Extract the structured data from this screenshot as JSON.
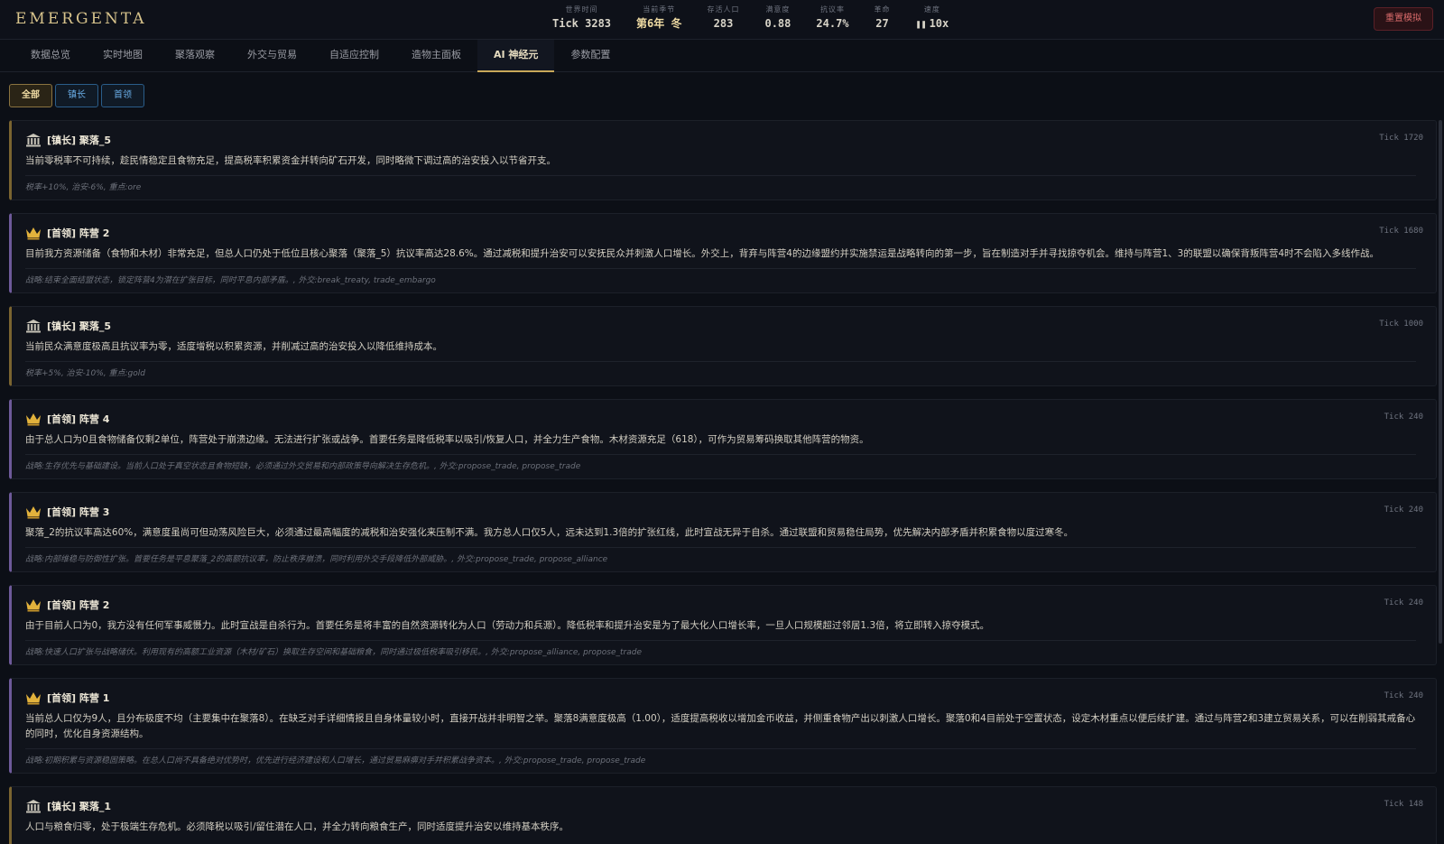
{
  "app": {
    "logo": "EMERGENTA"
  },
  "stats": [
    {
      "label": "世界时间",
      "value": "Tick 3283"
    },
    {
      "label": "当前季节",
      "value": "第6年 冬"
    },
    {
      "label": "存活人口",
      "value": "283"
    },
    {
      "label": "满意度",
      "value": "0.88"
    },
    {
      "label": "抗议率",
      "value": "24.7%"
    },
    {
      "label": "革命",
      "value": "27"
    },
    {
      "label": "速度",
      "value": "10x",
      "icon": "pause-icon"
    }
  ],
  "reset_label": "重置模拟",
  "tabs": [
    {
      "label": "数据总览"
    },
    {
      "label": "实时地图"
    },
    {
      "label": "聚落观察"
    },
    {
      "label": "外交与贸易"
    },
    {
      "label": "自适应控制"
    },
    {
      "label": "造物主面板"
    },
    {
      "label": "AI 神经元",
      "active": true
    },
    {
      "label": "参数配置"
    }
  ],
  "filters": [
    {
      "label": "全部",
      "active": true
    },
    {
      "label": "镇长"
    },
    {
      "label": "首领"
    }
  ],
  "colors": {
    "gold_accent": "#c9a85a",
    "mayor_border": "#7a6430",
    "leader_border": "#6e5a9a",
    "danger": "#d86a6a"
  },
  "cards": [
    {
      "kind": "mayor",
      "icon": "bank-icon",
      "title": "[镇长] 聚落_5",
      "tick": "Tick 1720",
      "body": "当前零税率不可持续，趁民情稳定且食物充足，提高税率积累资金并转向矿石开发，同时略微下调过高的治安投入以节省开支。",
      "note": "税率+10%, 治安-6%, 重点:ore"
    },
    {
      "kind": "leader",
      "icon": "crown-icon",
      "title": "[首领] 阵营 2",
      "tick": "Tick 1680",
      "body": "目前我方资源储备（食物和木材）非常充足，但总人口仍处于低位且核心聚落（聚落_5）抗议率高达28.6%。通过减税和提升治安可以安抚民众并刺激人口增长。外交上，背弃与阵营4的边缘盟约并实施禁运是战略转向的第一步，旨在制造对手并寻找掠夺机会。维持与阵营1、3的联盟以确保背叛阵营4时不会陷入多线作战。",
      "note": "战略:结束全面结盟状态，锁定阵营4为潜在扩张目标，同时平息内部矛盾。, 外交:break_treaty, trade_embargo"
    },
    {
      "kind": "mayor",
      "icon": "bank-icon",
      "title": "[镇长] 聚落_5",
      "tick": "Tick 1000",
      "body": "当前民众满意度极高且抗议率为零，适度增税以积累资源，并削减过高的治安投入以降低维持成本。",
      "note": "税率+5%, 治安-10%, 重点:gold"
    },
    {
      "kind": "leader",
      "icon": "crown-icon",
      "title": "[首领] 阵营 4",
      "tick": "Tick 240",
      "body": "由于总人口为0且食物储备仅剩2单位，阵营处于崩溃边缘。无法进行扩张或战争。首要任务是降低税率以吸引/恢复人口，并全力生产食物。木材资源充足（618），可作为贸易筹码换取其他阵营的物资。",
      "note": "战略:生存优先与基础建设。当前人口处于真空状态且食物短缺，必须通过外交贸易和内部政策导向解决生存危机。, 外交:propose_trade, propose_trade"
    },
    {
      "kind": "leader",
      "icon": "crown-icon",
      "title": "[首领] 阵营 3",
      "tick": "Tick 240",
      "body": "聚落_2的抗议率高达60%，满意度虽尚可但动荡风险巨大，必须通过最高幅度的减税和治安强化来压制不满。我方总人口仅5人，远未达到1.3倍的扩张红线，此时宣战无异于自杀。通过联盟和贸易稳住局势，优先解决内部矛盾并积累食物以度过寒冬。",
      "note": "战略:内部维稳与防御性扩张。首要任务是平息聚落_2的高额抗议率，防止秩序崩溃，同时利用外交手段降低外部威胁。, 外交:propose_trade, propose_alliance"
    },
    {
      "kind": "leader",
      "icon": "crown-icon",
      "title": "[首领] 阵营 2",
      "tick": "Tick 240",
      "body": "由于目前人口为0，我方没有任何军事威慑力。此时宣战是自杀行为。首要任务是将丰富的自然资源转化为人口（劳动力和兵源）。降低税率和提升治安是为了最大化人口增长率，一旦人口规模超过邻居1.3倍，将立即转入掠夺模式。",
      "note": "战略:快速人口扩张与战略储伏。利用现有的高额工业资源（木材/矿石）换取生存空间和基础粮食，同时通过极低税率吸引移民。, 外交:propose_alliance, propose_trade"
    },
    {
      "kind": "leader",
      "icon": "crown-icon",
      "title": "[首领] 阵营 1",
      "tick": "Tick 240",
      "body": "当前总人口仅为9人，且分布极度不均（主要集中在聚落8）。在缺乏对手详细情报且自身体量较小时，直接开战并非明智之举。聚落8满意度极高（1.00），适度提高税收以增加金币收益，并侧重食物产出以刺激人口增长。聚落0和4目前处于空置状态，设定木材重点以便后续扩建。通过与阵营2和3建立贸易关系，可以在削弱其戒备心的同时，优化自身资源结构。",
      "note": "战略:初期积累与资源稳固策略。在总人口尚不具备绝对优势时，优先进行经济建设和人口增长，通过贸易麻痹对手并积累战争资本。, 外交:propose_trade, propose_trade"
    },
    {
      "kind": "mayor",
      "icon": "bank-icon",
      "title": "[镇长] 聚落_1",
      "tick": "Tick 148",
      "body": "人口与粮食归零，处于极端生存危机。必须降税以吸引/留住潜在人口，并全力转向粮食生产，同时适度提升治安以维持基本秩序。",
      "note": ""
    }
  ]
}
